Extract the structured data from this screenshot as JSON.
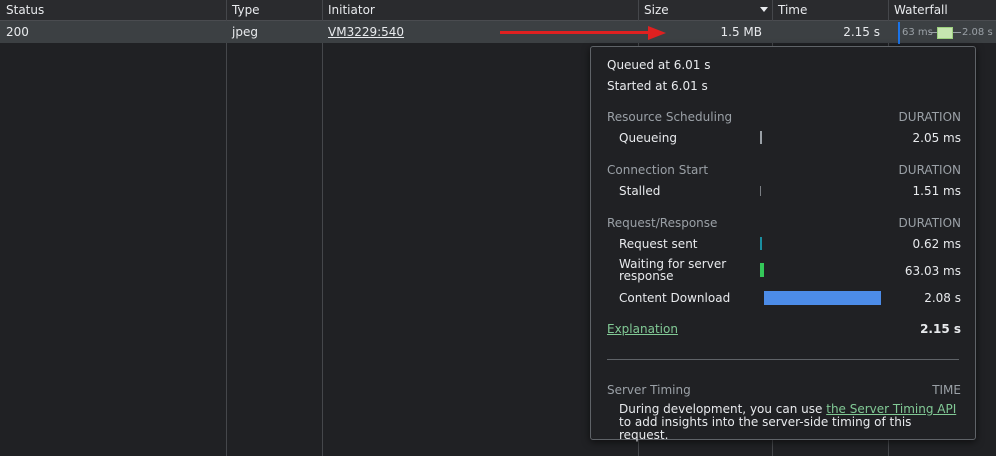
{
  "columns": {
    "status": "Status",
    "type": "Type",
    "initiator": "Initiator",
    "size": "Size",
    "time": "Time",
    "waterfall": "Waterfall"
  },
  "request_row": {
    "status": "200",
    "type": "jpeg",
    "initiator": "VM3229:540",
    "size": "1.5 MB",
    "time": "2.15 s",
    "waterfall_left_label": "63 ms",
    "waterfall_right_label": "2.08 s"
  },
  "popover": {
    "queued": "Queued at 6.01 s",
    "started": "Started at 6.01 s",
    "sections": {
      "resource_scheduling": "Resource Scheduling",
      "connection_start": "Connection Start",
      "request_response": "Request/Response",
      "duration_label": "DURATION"
    },
    "rows": {
      "queueing": {
        "label": "Queueing",
        "value": "2.05 ms"
      },
      "stalled": {
        "label": "Stalled",
        "value": "1.51 ms"
      },
      "request_sent": {
        "label": "Request sent",
        "value": "0.62 ms"
      },
      "waiting_line1": "Waiting for server",
      "waiting_line2": "response",
      "waiting_value": "63.03 ms",
      "content_download": {
        "label": "Content Download",
        "value": "2.08 s"
      }
    },
    "explanation": "Explanation",
    "total": "2.15 s",
    "server_timing": {
      "title": "Server Timing",
      "time_label": "TIME",
      "desc_prefix": "During development, you can use ",
      "desc_link": "the Server Timing API",
      "desc_suffix": " to add insights into the server-side timing of this request."
    }
  },
  "colors": {
    "queueing_bar": "#9aa0a6",
    "request_sent_bar": "#1a8ea0",
    "waiting_bar": "#34c759",
    "content_download_bar": "#4c8ce8",
    "arrow": "#e02020"
  }
}
